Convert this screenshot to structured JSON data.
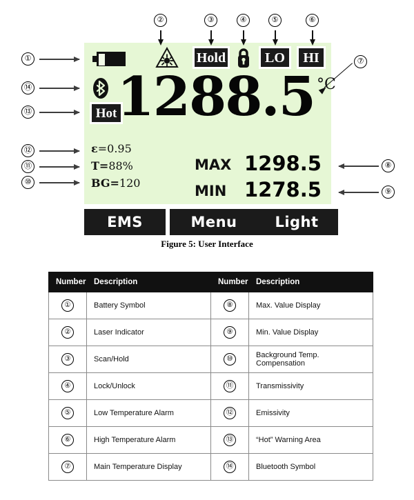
{
  "figure": {
    "caption": "Figure 5: User Interface",
    "lcd_bg_color": "#e6f7d5",
    "badge_bg_color": "#1b1b1b",
    "display": {
      "main_value": "1288.5",
      "main_unit": "°C",
      "badges": {
        "hold": "Hold",
        "lo": "LO",
        "hi": "HI",
        "hot": "Hot"
      },
      "icons": {
        "battery": "battery-icon",
        "laser": "laser-indicator-icon",
        "lock": "lock-icon",
        "bluetooth": "bluetooth-icon"
      },
      "params": {
        "emissivity_label": "ε",
        "emissivity_eq": "=",
        "emissivity_value": "0.95",
        "transmissivity_label": "T",
        "transmissivity_eq": "=",
        "transmissivity_value": "88%",
        "background_label": "BG",
        "background_eq": "=",
        "background_value": "120"
      },
      "max": {
        "label": "MAX",
        "value": "1298.5"
      },
      "min": {
        "label": "MIN",
        "value": "1278.5"
      }
    },
    "softkeys": [
      {
        "label": "EMS"
      },
      {
        "label": "Menu"
      },
      {
        "label": "Light"
      }
    ],
    "callouts": [
      {
        "id": "1",
        "text": "①"
      },
      {
        "id": "2",
        "text": "②"
      },
      {
        "id": "3",
        "text": "③"
      },
      {
        "id": "4",
        "text": "④"
      },
      {
        "id": "5",
        "text": "⑤"
      },
      {
        "id": "6",
        "text": "⑥"
      },
      {
        "id": "7",
        "text": "⑦"
      },
      {
        "id": "8",
        "text": "⑧"
      },
      {
        "id": "9",
        "text": "⑨"
      },
      {
        "id": "10",
        "text": "⑩"
      },
      {
        "id": "11",
        "text": "⑪"
      },
      {
        "id": "12",
        "text": "⑫"
      },
      {
        "id": "13",
        "text": "⑬"
      },
      {
        "id": "14",
        "text": "⑭"
      }
    ]
  },
  "table": {
    "headers": [
      "Number",
      "Description",
      "Number",
      "Description"
    ],
    "rows": [
      {
        "n1": "①",
        "d1": "Battery Symbol",
        "n2": "⑧",
        "d2": "Max. Value Display"
      },
      {
        "n1": "②",
        "d1": "Laser Indicator",
        "n2": "⑨",
        "d2": "Min. Value Display"
      },
      {
        "n1": "③",
        "d1": "Scan/Hold",
        "n2": "⑩",
        "d2": "Background Temp. Compensation"
      },
      {
        "n1": "④",
        "d1": "Lock/Unlock",
        "n2": "⑪",
        "d2": "Transmissivity"
      },
      {
        "n1": "⑤",
        "d1": "Low Temperature Alarm",
        "n2": "⑫",
        "d2": "Emissivity"
      },
      {
        "n1": "⑥",
        "d1": "High Temperature Alarm",
        "n2": "⑬",
        "d2": "“Hot” Warning Area"
      },
      {
        "n1": "⑦",
        "d1": "Main Temperature Display",
        "n2": "⑭",
        "d2": "Bluetooth Symbol"
      }
    ]
  }
}
